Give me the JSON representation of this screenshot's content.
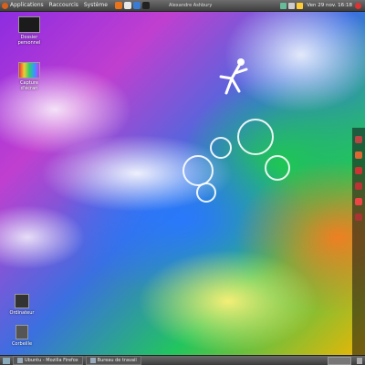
{
  "top_panel": {
    "menus": [
      "Applications",
      "Raccourcis",
      "Système"
    ],
    "window_title": "Alexandre Ashbury",
    "tray_text": "Ven 29 nov. 16:18"
  },
  "desktop_icons": [
    {
      "label": "Dossier personnel"
    },
    {
      "label": "Capture d'écran"
    },
    {
      "label": "Ordinateur"
    },
    {
      "label": "Corbeille"
    }
  ],
  "bottom_panel": {
    "tasks": [
      "Ubuntu - Mozilla Firefox",
      "Bureau de travail"
    ]
  },
  "colors": {
    "panel": "#4a4a4a",
    "accent": "#d9601a"
  }
}
